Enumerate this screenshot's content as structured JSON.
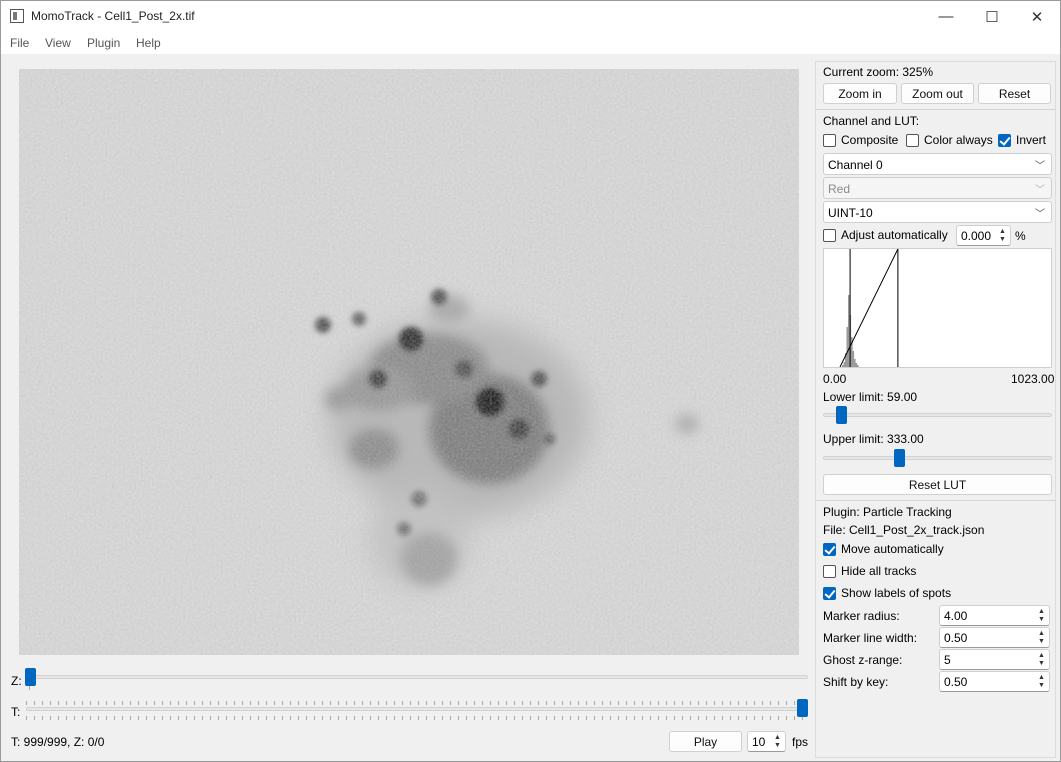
{
  "window": {
    "title": "MomoTrack - Cell1_Post_2x.tif",
    "minimize": "—",
    "maximize": "☐",
    "close": "✕"
  },
  "menu": {
    "items": [
      "File",
      "View",
      "Plugin",
      "Help"
    ]
  },
  "sliders": {
    "z_label": "Z:",
    "t_label": "T:",
    "z_value": 0,
    "z_max": 0,
    "t_value": 999,
    "t_max": 999
  },
  "status": {
    "text": "T: 999/999, Z: 0/0"
  },
  "playback": {
    "play_label": "Play",
    "fps_value": "10",
    "fps_unit": "fps"
  },
  "panel": {
    "zoom_text": "Current zoom: 325%",
    "zoom_in": "Zoom in",
    "zoom_out": "Zoom out",
    "reset": "Reset",
    "channel_title": "Channel and LUT:",
    "composite": {
      "label": "Composite",
      "checked": false
    },
    "color_always": {
      "label": "Color always",
      "checked": false
    },
    "invert": {
      "label": "Invert",
      "checked": true
    },
    "channel_select": "Channel 0",
    "color_select": "Red",
    "depth_select": "UINT-10",
    "adjust_auto": {
      "label": "Adjust automatically",
      "checked": false
    },
    "adjust_value": "0.000",
    "adjust_unit": "%",
    "hist_min": "0.00",
    "hist_max": "1023.00",
    "lower_label": "Lower limit: 59.00",
    "upper_label": "Upper limit: 333.00",
    "lower_value": 59,
    "upper_value": 333,
    "range_max": 1023,
    "reset_lut": "Reset LUT",
    "plugin_text": "Plugin: Particle Tracking",
    "file_text": "File: Cell1_Post_2x_track.json",
    "move_auto": {
      "label": "Move automatically",
      "checked": true
    },
    "hide_tracks": {
      "label": "Hide all tracks",
      "checked": false
    },
    "show_labels": {
      "label": "Show labels of spots",
      "checked": true
    },
    "marker_radius": {
      "label": "Marker radius:",
      "value": "4.00"
    },
    "marker_line": {
      "label": "Marker line width:",
      "value": "0.50"
    },
    "ghost_z": {
      "label": "Ghost z-range:",
      "value": "5"
    },
    "shift_key": {
      "label": "Shift by key:",
      "value": "0.50"
    }
  },
  "colors": {
    "accent": "#0067c0"
  }
}
